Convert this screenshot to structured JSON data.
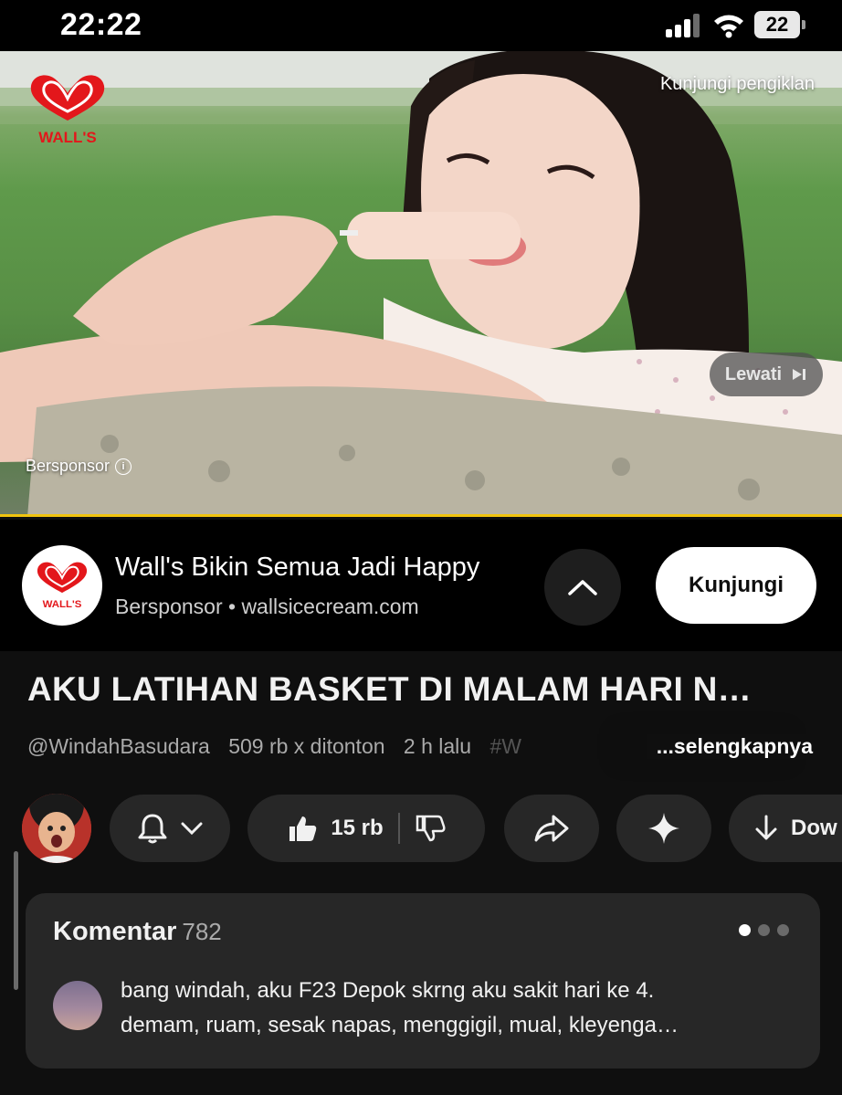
{
  "status_bar": {
    "time": "22:22",
    "battery": "22"
  },
  "ad_video": {
    "brand_logo_text": "WALL'S",
    "visit_advertiser": "Kunjungi pengiklan",
    "skip_label": "Lewati",
    "sponsored_tag": "Bersponsor",
    "progress_accent_color": "#f1c40f"
  },
  "ad_bar": {
    "title": "Wall's Bikin Semua Jadi Happy",
    "subtitle": "Bersponsor • wallsicecream.com",
    "visit_button": "Kunjungi",
    "logo_text": "WALL'S"
  },
  "video": {
    "title": "AKU LATIHAN BASKET DI MALAM HARI N…",
    "channel_handle": "@WindahBasudara",
    "views": "509 rb x ditonton",
    "time_ago": "2 h lalu",
    "hashtag": "#W",
    "more_label": "...selengkapnya"
  },
  "actions": {
    "like_count": "15 rb",
    "download_label": "Dow"
  },
  "comments": {
    "header": "Komentar",
    "count": "782",
    "top_comment_line1": "bang windah, aku F23 Depok skrng aku sakit hari ke 4.",
    "top_comment_line2": "demam, ruam, sesak napas, menggigil, mual, kleyenga…"
  }
}
